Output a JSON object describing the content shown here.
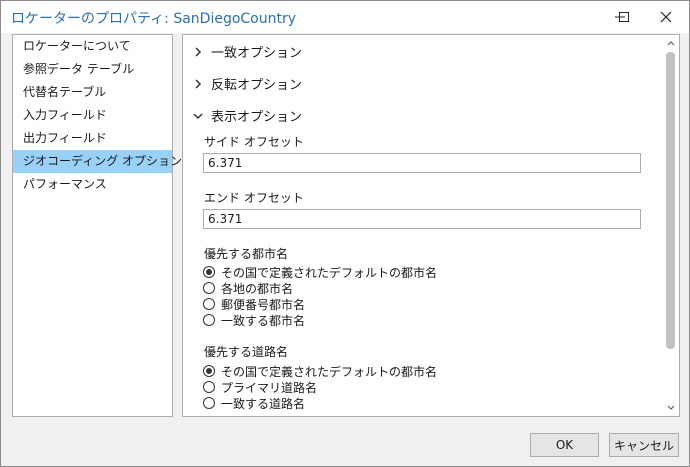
{
  "window": {
    "title": "ロケーターのプロパティ: SanDiegoCountry"
  },
  "nav": {
    "items": [
      {
        "label": "ロケーターについて"
      },
      {
        "label": "参照データ テーブル"
      },
      {
        "label": "代替名テーブル"
      },
      {
        "label": "入力フィールド"
      },
      {
        "label": "出力フィールド"
      },
      {
        "label": "ジオコーディング オプション"
      },
      {
        "label": "パフォーマンス"
      }
    ],
    "selected": "ジオコーディング オプション"
  },
  "content": {
    "sections": {
      "match": {
        "label": "一致オプション",
        "expanded": false
      },
      "reverse": {
        "label": "反転オプション",
        "expanded": false
      },
      "display": {
        "label": "表示オプション",
        "expanded": true
      }
    },
    "side_offset": {
      "label": "サイド オフセット",
      "value": "6.371"
    },
    "end_offset": {
      "label": "エンド オフセット",
      "value": "6.371"
    },
    "preferred_city": {
      "label": "優先する都市名",
      "options": [
        {
          "label": "その国で定義されたデフォルトの都市名",
          "checked": true
        },
        {
          "label": "各地の都市名",
          "checked": false
        },
        {
          "label": "郵便番号都市名",
          "checked": false
        },
        {
          "label": "一致する都市名",
          "checked": false
        }
      ]
    },
    "preferred_street": {
      "label": "優先する道路名",
      "options": [
        {
          "label": "その国で定義されたデフォルトの都市名",
          "checked": true
        },
        {
          "label": "プライマリ道路名",
          "checked": false
        },
        {
          "label": "一致する道路名",
          "checked": false
        }
      ]
    }
  },
  "footer": {
    "ok_label": "OK",
    "cancel_label": "キャンセル"
  },
  "colors": {
    "title_text": "#2b6fb6",
    "selected_item": "#99d1f7"
  },
  "icons": [
    "minimize-icon",
    "maximize-icon",
    "close-icon",
    "chevron-right-icon",
    "chevron-down-icon",
    "scroll-up-icon",
    "scroll-down-icon"
  ]
}
